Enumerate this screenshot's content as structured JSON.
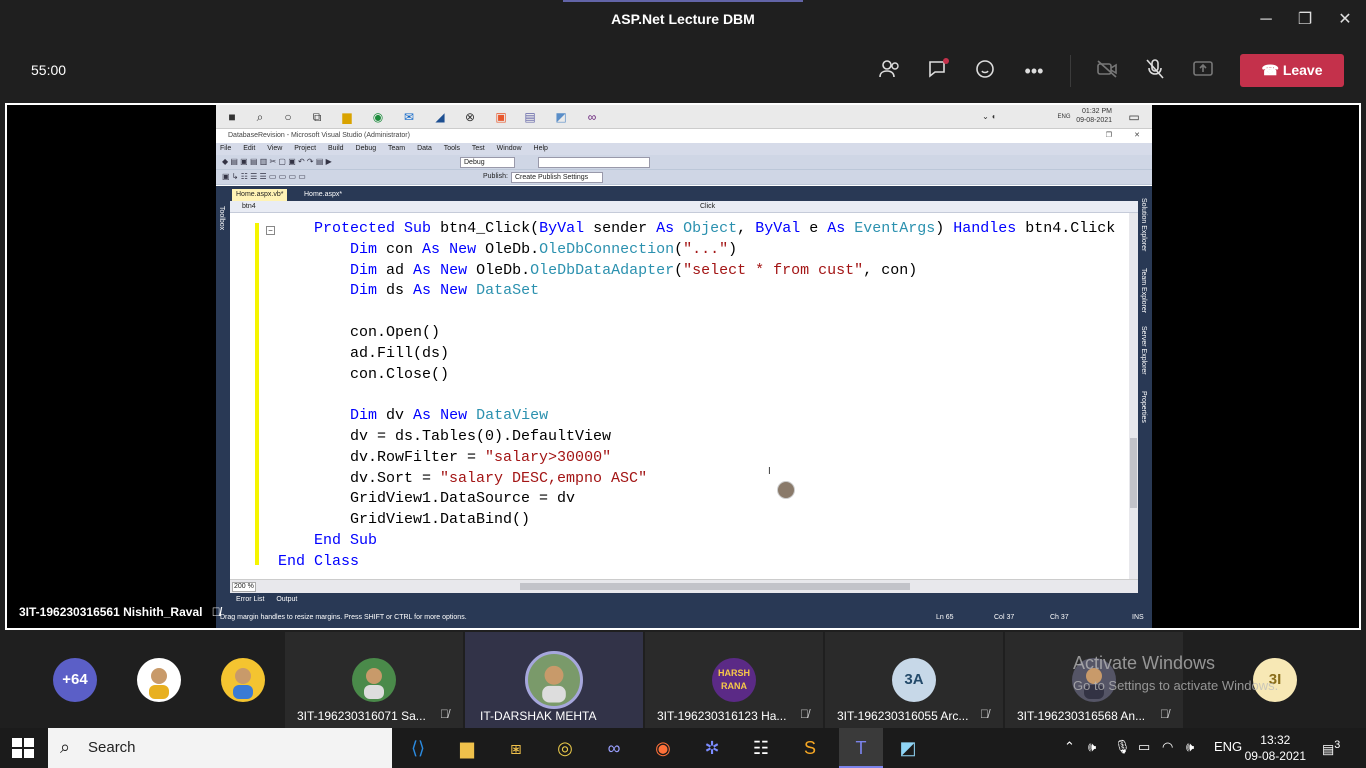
{
  "window": {
    "title": "ASP.Net Lecture DBM"
  },
  "call": {
    "timer": "55:00",
    "leave_label": "Leave"
  },
  "remote": {
    "clock_time": "01:32 PM",
    "clock_date": "09-08-2021",
    "lang": "ENG",
    "vs_title": "DatabaseRevision - Microsoft Visual Studio (Administrator)",
    "menu": [
      "File",
      "Edit",
      "View",
      "Project",
      "Build",
      "Debug",
      "Team",
      "Data",
      "Tools",
      "Test",
      "Window",
      "Help"
    ],
    "config": "Debug",
    "publish_label": "Publish:",
    "publish_value": "Create Publish Settings",
    "tabs": [
      "Home.aspx.vb*",
      "Home.aspx*"
    ],
    "nav_left": "btn4",
    "nav_right": "Click",
    "zoom": "200 %",
    "bottom_tabs": [
      "Error List",
      "Output"
    ],
    "status": "Drag margin handles to resize margins. Press SHIFT or CTRL for more options.",
    "ln": "Ln 65",
    "col": "Col 37",
    "ch": "Ch 37",
    "ins": "INS",
    "toolbox": "Toolbox",
    "right_dock": [
      "Solution Explorer",
      "Team Explorer",
      "Server Explorer",
      "Properties"
    ]
  },
  "code_lines": [
    "    Protected Sub btn4_Click(ByVal sender As Object, ByVal e As EventArgs) Handles btn4.Click",
    "        Dim con As New OleDb.OleDbConnection(\"...\")",
    "        Dim ad As New OleDb.OleDbDataAdapter(\"select * from cust\", con)",
    "        Dim ds As New DataSet",
    "",
    "        con.Open()",
    "        ad.Fill(ds)",
    "        con.Close()",
    "",
    "        Dim dv As New DataView",
    "        dv = ds.Tables(0).DefaultView",
    "        dv.RowFilter = \"salary>30000\"",
    "        dv.Sort = \"salary DESC,empno ASC\"",
    "        GridView1.DataSource = dv",
    "        GridView1.DataBind()",
    "    End Sub",
    "End Class"
  ],
  "presenter_name": "3IT-196230316561 Nishith_Raval",
  "participants": {
    "overflow_count": "+64",
    "tiles": [
      {
        "name": "3IT-196230316071 Sa...",
        "initials": ""
      },
      {
        "name": "IT-DARSHAK MEHTA",
        "initials": ""
      },
      {
        "name": "3IT-196230316123 Ha...",
        "initials": "HARSH RANA"
      },
      {
        "name": "3IT-196230316055 Arc...",
        "initials": "3A"
      },
      {
        "name": "3IT-196230316568 An...",
        "initials": ""
      }
    ],
    "extra_avatar": "3I"
  },
  "activate": {
    "line1": "Activate Windows",
    "line2": "Go to Settings to activate Windows."
  },
  "taskbar": {
    "search_label": "Search",
    "lang": "ENG",
    "time": "13:32",
    "date": "09-08-2021",
    "notifications": "3"
  },
  "colors": {
    "leave": "#c4314b",
    "teams_accent": "#6264a7",
    "vs_chrome": "#293955",
    "keyword": "#0000ff",
    "type": "#2b91af",
    "string": "#a31515"
  }
}
